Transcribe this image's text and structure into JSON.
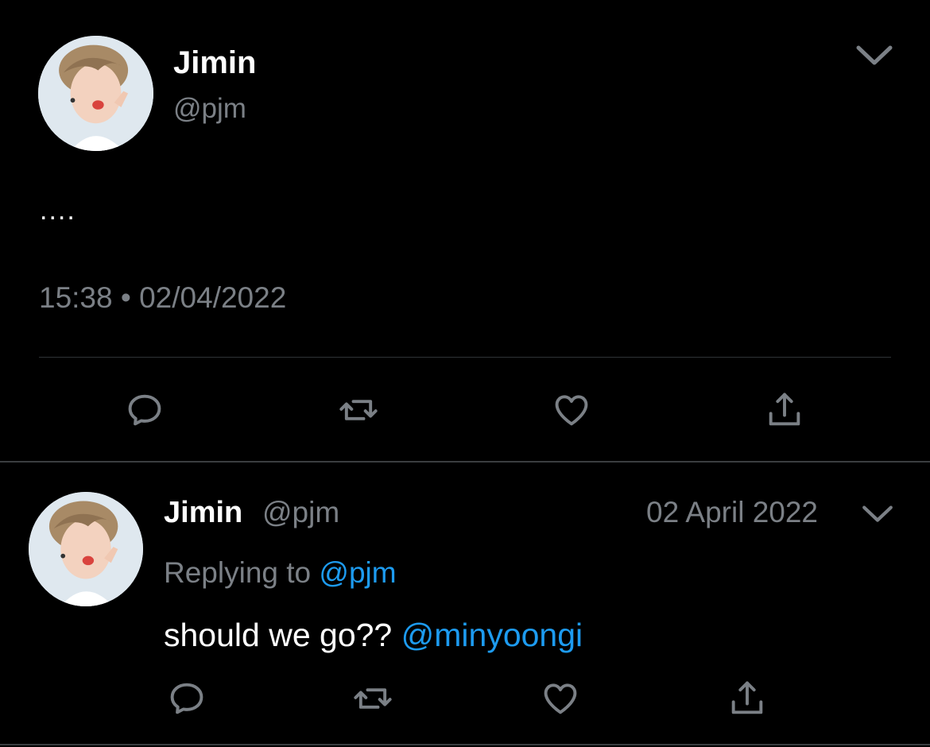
{
  "main_tweet": {
    "name": "Jimin",
    "handle": "@pjm",
    "text": "....",
    "timestamp": "15:38 • 02/04/2022",
    "menu_icon": "chevron-down-icon",
    "actions": [
      {
        "icon": "reply-icon"
      },
      {
        "icon": "retweet-icon"
      },
      {
        "icon": "like-icon"
      },
      {
        "icon": "share-icon"
      }
    ]
  },
  "reply_tweet": {
    "name": "Jimin",
    "handle": "@pjm",
    "date": "02 April 2022",
    "replying_prefix": "Replying to",
    "replying_handle": "@pjm",
    "text": "should we go??",
    "mention": "@minyoongi",
    "menu_icon": "chevron-down-icon",
    "actions": [
      {
        "icon": "reply-icon"
      },
      {
        "icon": "retweet-icon"
      },
      {
        "icon": "like-icon"
      },
      {
        "icon": "share-icon"
      }
    ]
  },
  "colors": {
    "background": "#000000",
    "primary_text": "#ffffff",
    "secondary_text": "#7b8086",
    "link": "#1d9bf0",
    "icon": "#7b8086",
    "divider": "#2f3336"
  }
}
